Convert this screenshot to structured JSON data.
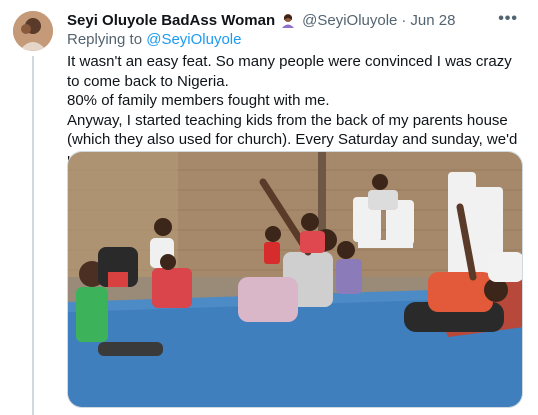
{
  "tweet": {
    "author_name": "Seyi Oluyole BadAss Woman",
    "author_emoji_icon": "woman-teacher-emoji-icon",
    "handle": "@SeyiOluyole",
    "separator": "·",
    "date": "Jun 28",
    "more_icon": "more-dots-icon",
    "more_glyph": "•••",
    "replying_prefix": "Replying to",
    "replying_to": "@SeyiOluyole",
    "text_lines": [
      "It wasn't an easy feat. So many people were convinced I was crazy to come back to Nigeria.",
      "80% of family members fought with me.",
      "Anyway, I started teaching kids from the back of my parents house (which they also used for church). Every Saturday and sunday, we'd use that place."
    ]
  },
  "colors": {
    "text": "#0f1419",
    "secondary": "#536471",
    "link": "#1d9bf0",
    "divider": "#cfd9de",
    "mat_blue": "#3f7fbd",
    "brick_wall": "#a6896a"
  }
}
